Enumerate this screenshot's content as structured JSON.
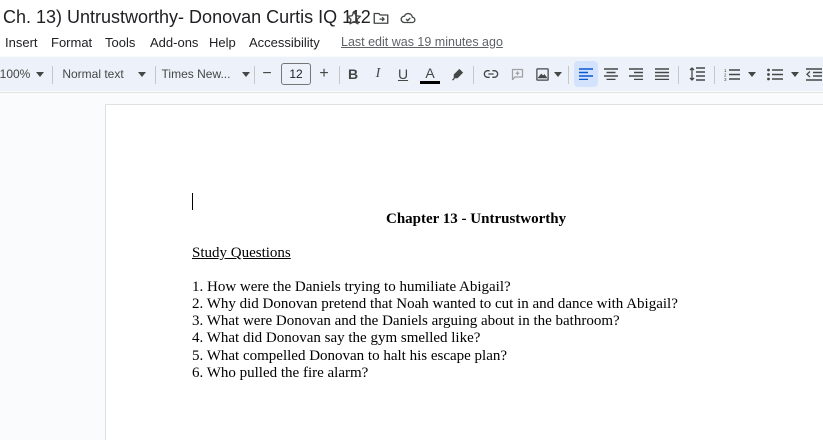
{
  "titlebar": {
    "title": "Ch. 13) Untrustworthy- Donovan Curtis IQ 112",
    "icons": [
      "star-icon",
      "move-to-folder-icon",
      "cloud-status-icon"
    ]
  },
  "menu": {
    "items": [
      "Insert",
      "Format",
      "Tools",
      "Add-ons",
      "Help",
      "Accessibility"
    ],
    "last_edit": "Last edit was 19 minutes ago"
  },
  "toolbar": {
    "zoom": "100%",
    "style": "Normal text",
    "font": "Times New...",
    "font_size": "12",
    "minus": "−",
    "plus": "+",
    "bold": "B",
    "italic": "I",
    "underline": "U",
    "text_color_label": "A",
    "text_color": "#000000",
    "active_alignment": "left"
  },
  "document": {
    "heading": "Chapter 13 - Untrustworthy",
    "subheading": "Study Questions",
    "questions": [
      "1. How were the Daniels trying to humiliate Abigail?",
      "2. Why did Donovan pretend that Noah wanted to cut in and dance with Abigail?",
      "3. What were Donovan and the Daniels arguing about in the bathroom?",
      "4. What did Donovan say the gym smelled like?",
      "5. What compelled Donovan to halt his escape plan?",
      "6. Who pulled the fire alarm?"
    ]
  },
  "colors": {
    "toolbar_bg": "#edf2fa",
    "active_button_bg": "#d3e3fd",
    "canvas_bg": "#f9fbfd",
    "icon_gray": "#444746"
  }
}
